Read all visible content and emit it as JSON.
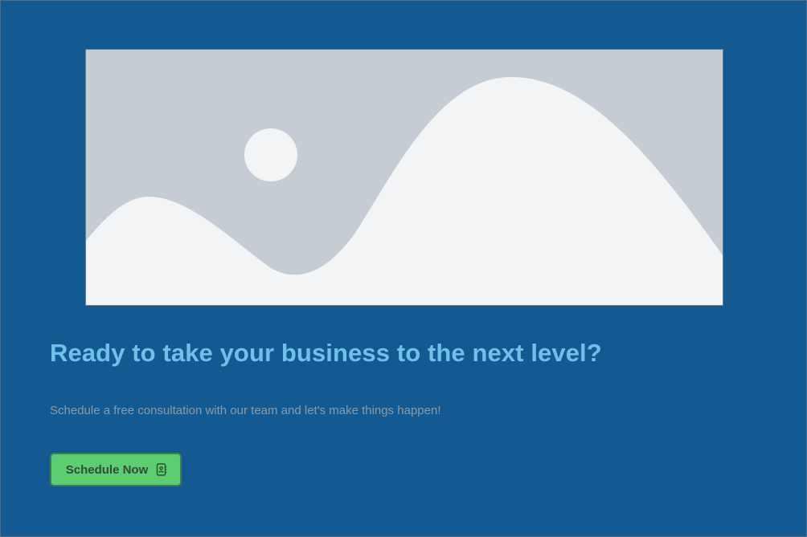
{
  "hero": {
    "image_icon": "image-placeholder-icon"
  },
  "content": {
    "headline": "Ready to take your business to the next level?",
    "subtext": "Schedule a free consultation with our team and let's make things happen!"
  },
  "cta": {
    "label": "Schedule Now",
    "icon": "contact-book-icon"
  },
  "colors": {
    "background": "#145a92",
    "headline": "#71c0ea",
    "subtext": "#8a9aa8",
    "button": "#5ccd70"
  }
}
